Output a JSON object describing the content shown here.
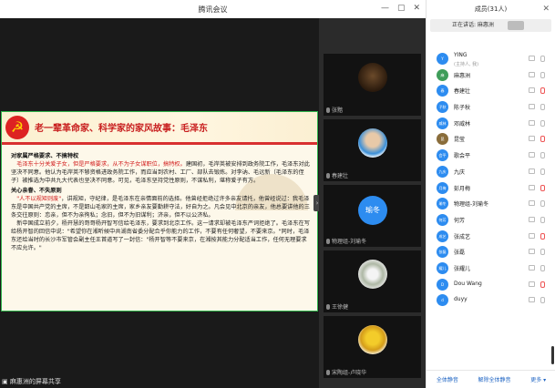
{
  "window": {
    "title": "腾讯会议",
    "min": "—",
    "max": "▢",
    "close": "✕"
  },
  "slide": {
    "title": "老一辈革命家、科学家的家风故事：毛泽东",
    "section1_heading": "对家属严格要求、不搞特权",
    "section1_red": "毛泽东十分关爱子女，但是严格要求，从不为子女谋职位，搞特权。",
    "section1_text": "建国初，毛岸英被安排到政务院工作，毛泽东对此坚决不同意。他认为毛岸英不够资格进政务院工作，而应当到农村、工厂、部队去锻炼。对李讷、毛远新（毛泽东的侄子）被推选为中共九大代表也坚决不同意。可见，毛泽东坚持党性原则，不谋私利，堪称爱子有方。",
    "section2_heading": "关心亲眷、不失原则",
    "section2_red": "\"人不以规矩则废\"",
    "section2_text": "，讲规矩，守纪律，是毛泽东在亲情面前的选择。他曾经拒绝过许多亲友请托，他曾经说过：我毛泽东是中国共产党的主席，不是韶山毛家的主席，家乡亲友要勤耕守法，好自为之。凡会见中北京的亲友，他总要讲他的三条交往原则：恋亲，但不为亲徇私；念旧，但不为旧谋利；济亲，但不以公济私。",
    "section2_text2": "新中国成立前夕，杨开慧的哥哥杨开智写信给毛泽东，要求到北京工作。这一请求却被毛泽东严词拒绝了。毛泽东在写给杨开智的回信中说：\"希望你在湘听候中共湖南省委分配合乎你能力的工作，不要有任何奢望，不要来京。\"同时，毛泽东还给当时的长沙市军管会副主任王首道写了一封信：\"杨开智等不要来京，在湘按其能力分配适当工作，任何无理要求不应允许。\""
  },
  "share_label": "麻惠洲的屏幕共享",
  "collapse": "›",
  "thumbs": [
    {
      "label": "张黯",
      "type": "photo-dark"
    },
    {
      "label": "春建壮",
      "type": "photo-person"
    },
    {
      "label": "物理组-刘瑜冬",
      "type": "text",
      "avatar": "瑜冬"
    },
    {
      "label": "王徐健",
      "type": "photo-flower"
    },
    {
      "label": "宋陶组-卢晓华",
      "type": "photo-yellow"
    }
  ],
  "panel": {
    "title": "成员(31人)",
    "close": "✕",
    "speaking": "正在讲话: 麻惠洲",
    "members": [
      {
        "name": "YING",
        "sub": "(主持人, 我)",
        "avatar": "Y"
      },
      {
        "name": "麻惠洲",
        "avatar": "麻"
      },
      {
        "name": "春建壮",
        "avatar": "春"
      },
      {
        "name": "陈子秋",
        "avatar": "子秋"
      },
      {
        "name": "邓威林",
        "avatar": "威林"
      },
      {
        "name": "昆莹",
        "avatar": "昆"
      },
      {
        "name": "歌会平",
        "avatar": "会平"
      },
      {
        "name": "九庆",
        "avatar": "九庆"
      },
      {
        "name": "彭月梅",
        "avatar": "月梅"
      },
      {
        "name": "物理组-刘瑜冬",
        "avatar": "瑜冬"
      },
      {
        "name": "何芳",
        "avatar": "何芳"
      },
      {
        "name": "张成艺",
        "avatar": "成艺"
      },
      {
        "name": "张磊",
        "avatar": "张磊"
      },
      {
        "name": "张耀儿",
        "avatar": "耀儿"
      },
      {
        "name": "Dou Wang",
        "avatar": "D"
      },
      {
        "name": "duyy",
        "avatar": "d"
      }
    ],
    "mute_all": "全体静音",
    "unmute_all": "解除全体静音",
    "more": "更多 ▾"
  }
}
